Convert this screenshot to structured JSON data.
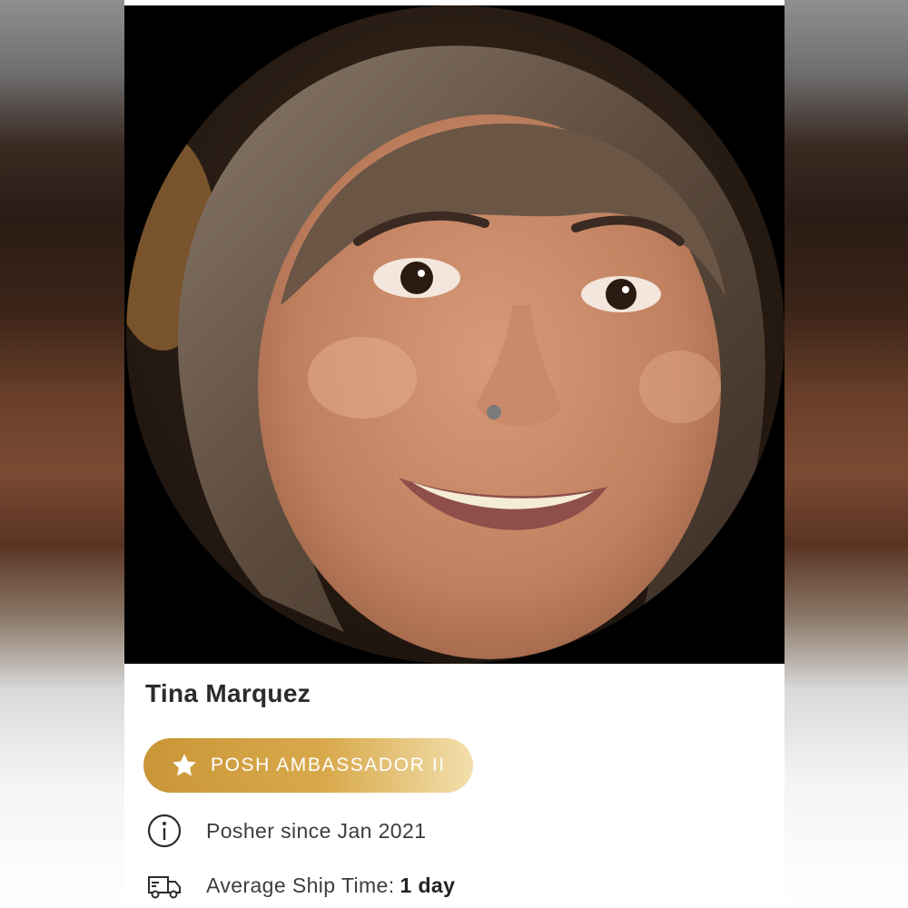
{
  "profile": {
    "name": "Tina Marquez",
    "avatar_icon": "profile-photo",
    "badge": {
      "label": "POSH AMBASSADOR II",
      "icon": "star-icon",
      "gradient_start": "#c99637",
      "gradient_end": "#f3dfad"
    },
    "since_text": "Posher since Jan 2021",
    "since_icon": "info-icon",
    "ship_label": "Average Ship Time:",
    "ship_value": "1 day",
    "ship_icon": "truck-icon"
  }
}
